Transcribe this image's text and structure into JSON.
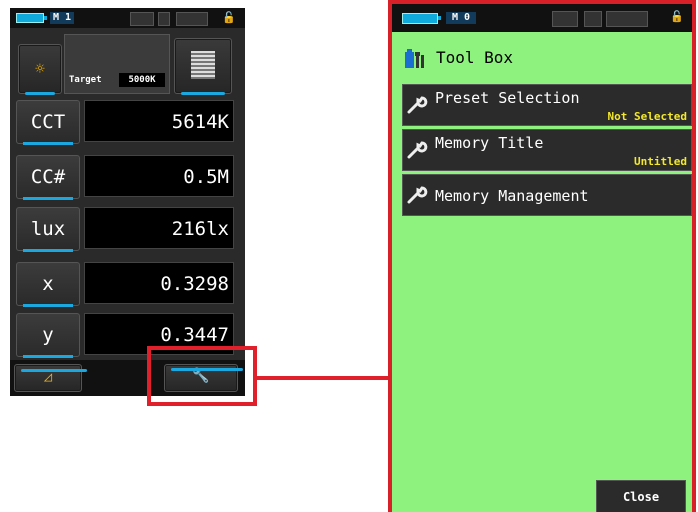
{
  "left_screen": {
    "status": {
      "memory_label": "M 1"
    },
    "target": {
      "label": "Target",
      "value": "5000K"
    },
    "measurements": [
      {
        "label": "CCT",
        "value": "5614K"
      },
      {
        "label": "CC#",
        "value": "0.5M"
      },
      {
        "label": "lux",
        "value": "216lx"
      },
      {
        "label": "x",
        "value": "0.3298"
      },
      {
        "label": "y",
        "value": "0.3447"
      }
    ],
    "icons": {
      "illuminant": "sun-icon",
      "memory": "grid-icon",
      "triangle": "delta-icon",
      "tools": "wrench-icon"
    }
  },
  "right_screen": {
    "status": {
      "memory_label": "M 0"
    },
    "title": "Tool Box",
    "items": [
      {
        "name": "Preset Selection",
        "value": "Not Selected"
      },
      {
        "name": "Memory Title",
        "value": "Untitled"
      },
      {
        "name": "Memory Management",
        "value": ""
      }
    ],
    "close_label": "Close"
  },
  "colors": {
    "highlight": "#e0202a",
    "accent_blue": "#1ba7e0",
    "screen_green": "#8ef27f",
    "value_yellow": "#f3e82a"
  }
}
